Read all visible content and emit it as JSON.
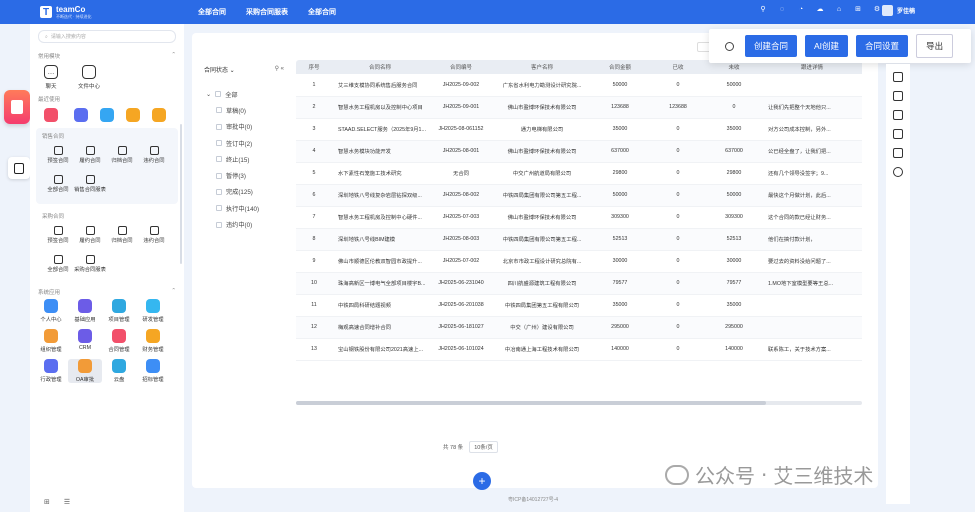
{
  "header": {
    "brand": "teamCo",
    "brand_sub": "不断迭代 · 持续进化",
    "nav": [
      "全部合同",
      "采购合同服表",
      "全部合同"
    ],
    "user": "罗佳楠"
  },
  "sidebar": {
    "search_placeholder": "请输入搜索内容",
    "common_title": "常用模块",
    "common_items": [
      "聊天",
      "文件中心"
    ],
    "recent_title": "最近使用",
    "sales_title": "销售合同",
    "sales_items": [
      "预签合同",
      "履约合同",
      "归档合同",
      "违约合同",
      "全部合同",
      "销售合同服表"
    ],
    "purchase_title": "采购合同",
    "purchase_items": [
      "预签合同",
      "履约合同",
      "归档合同",
      "违约合同",
      "全部合同",
      "采购合同服表"
    ],
    "system_title": "系统应用",
    "system_items": [
      "个人中心",
      "基础应用",
      "项目管理",
      "研发管理",
      "组织管理",
      "CRM",
      "合同管理",
      "财务管理",
      "行政管理",
      "OA审批",
      "云盘",
      "招标管理"
    ]
  },
  "actions": {
    "create": "创建合同",
    "ai_create": "AI创建",
    "settings": "合同设置",
    "export": "导出"
  },
  "filter": {
    "title": "合同状态",
    "all": "全部",
    "options": [
      "草稿(0)",
      "审批中(0)",
      "签订中(2)",
      "终止(15)",
      "暂停(3)",
      "完成(125)",
      "执行中(140)",
      "违约中(0)"
    ]
  },
  "table": {
    "columns": [
      "序号",
      "合同名称",
      "合同编号",
      "客户名称",
      "合同金额",
      "已收",
      "未收",
      "跟进详情"
    ],
    "rows": [
      [
        "1",
        "艾三维支模协同系统售后服务合同",
        "JH2025-09-002",
        "广东省水利电力勘测设计研究院...",
        "50000",
        "0",
        "50000",
        ""
      ],
      [
        "2",
        "智慧水务工程机房以及控制中心项目",
        "JH2025-09-001",
        "佛山市盈博环保技术有限公司",
        "123688",
        "123688",
        "0",
        "让我们先把整个天地他只..."
      ],
      [
        "3",
        "STAAD.SELECT服务（2025年9月1...",
        "JH2025-08-061152",
        "通力电梯有限公司",
        "35000",
        "0",
        "35000",
        "对方公司成本控制，另外..."
      ],
      [
        "4",
        "智慧水务模块功能开发",
        "JH2025-08-001",
        "佛山市盈博环保技术有限公司",
        "637000",
        "0",
        "637000",
        "公已经全盘了，让我们把..."
      ],
      [
        "5",
        "水下素性石笼施工技术研究",
        "无合同",
        "中交广州航道局有限公司",
        "29800",
        "0",
        "29800",
        "还有几个领导没签字；9..."
      ],
      [
        "6",
        "深圳地铁八号线复杂岩层钻探双级...",
        "JH2025-08-002",
        "中铁四局集团有限公司第五工程...",
        "50000",
        "0",
        "50000",
        "最快这个月做计划，此后..."
      ],
      [
        "7",
        "智慧水务工程机房及控制中心硬件...",
        "JH2025-07-003",
        "佛山市盈博环保技术有限公司",
        "309300",
        "0",
        "309300",
        "这个合同的款已经让财务..."
      ],
      [
        "8",
        "深圳地铁八号线BIM建模",
        "JH2025-08-003",
        "中铁四局集团有限公司第五工程...",
        "52513",
        "0",
        "52513",
        "他们在搞付款计划，"
      ],
      [
        "9",
        "佛山市顺德区伦教双智园市政提升...",
        "JH2025-07-002",
        "北京市市政工程设计研究总院有...",
        "30000",
        "0",
        "30000",
        "要过去的资料没给问题了..."
      ],
      [
        "10",
        "珠海高新区一博电气全部项目楼宇B...",
        "JH2025-06-231040",
        "四川航盛源建筑工程有限公司",
        "79577",
        "0",
        "79577",
        "1.MO地下室模型要等王总..."
      ],
      [
        "11",
        "中铁四局科研结题视频",
        "JH2025-06-201038",
        "中铁四局集团第五工程有限公司",
        "35000",
        "0",
        "35000",
        ""
      ],
      [
        "12",
        "梅观高速合同增补合同",
        "JH2025-06-181027",
        "中交（广州）建设有限公司",
        "295000",
        "0",
        "295000",
        ""
      ],
      [
        "13",
        "宝山钢铁股份有限公司2021高速上...",
        "JH2025-06-101024",
        "中冶南通上海工程技术有限公司",
        "140000",
        "0",
        "140000",
        "联系陈工，关于技术方案..."
      ]
    ]
  },
  "pager": {
    "total": "共 78 条",
    "page_size": "10条/页"
  },
  "footer": {
    "icp": "粤ICP备14012727号-4"
  },
  "watermark": {
    "left": "公众号",
    "sep": "·",
    "right": "艾三维技术"
  }
}
